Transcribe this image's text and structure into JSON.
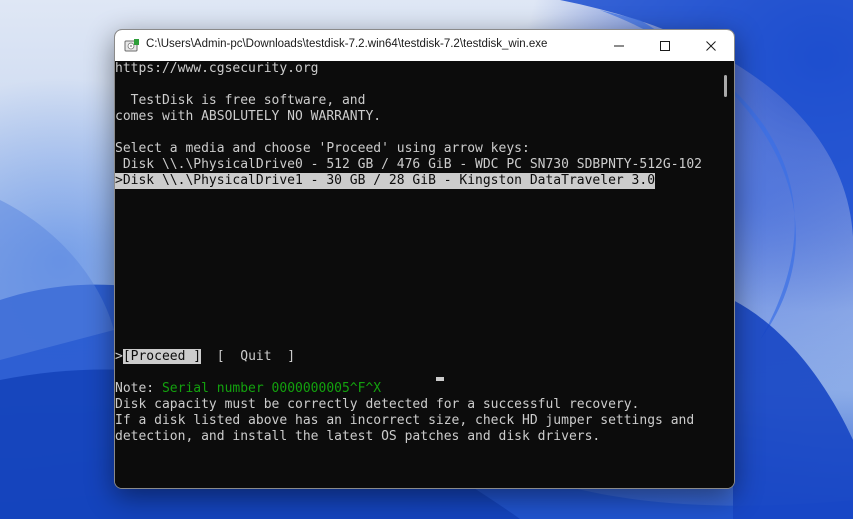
{
  "window": {
    "title": "C:\\Users\\Admin-pc\\Downloads\\testdisk-7.2.win64\\testdisk-7.2\\testdisk_win.exe",
    "app_icon": "testdisk-app-icon",
    "buttons": {
      "minimize_icon": "minimize-icon",
      "maximize_icon": "maximize-icon",
      "close_icon": "close-icon"
    }
  },
  "console": {
    "url_line": "https://www.cgsecurity.org",
    "free_line1": "  TestDisk is free software, and",
    "free_line2": "comes with ABSOLUTELY NO WARRANTY.",
    "prompt": "Select a media and choose 'Proceed' using arrow keys:",
    "disks": [
      " Disk \\\\.\\PhysicalDrive0 - 512 GB / 476 GiB - WDC PC SN730 SDBPNTY-512G-102",
      ">Disk \\\\.\\PhysicalDrive1 - 30 GB / 28 GiB - Kingston DataTraveler 3.0"
    ],
    "selected_disk_index": 1,
    "menu": {
      "proceed_marker": ">",
      "proceed_label": "[Proceed ]",
      "quit_label": "[  Quit  ]"
    },
    "note_label": "Note: ",
    "serial_text": "Serial number 0000000005^F^X",
    "note_lines": [
      "Disk capacity must be correctly detected for a successful recovery.",
      "If a disk listed above has an incorrect size, check HD jumper settings and",
      "detection, and install the latest OS patches and disk drivers."
    ]
  },
  "colors": {
    "console_bg": "#0c0c0c",
    "console_fg": "#cccccc",
    "highlight_bg": "#cccccc",
    "serial_green": "#13a10e"
  }
}
